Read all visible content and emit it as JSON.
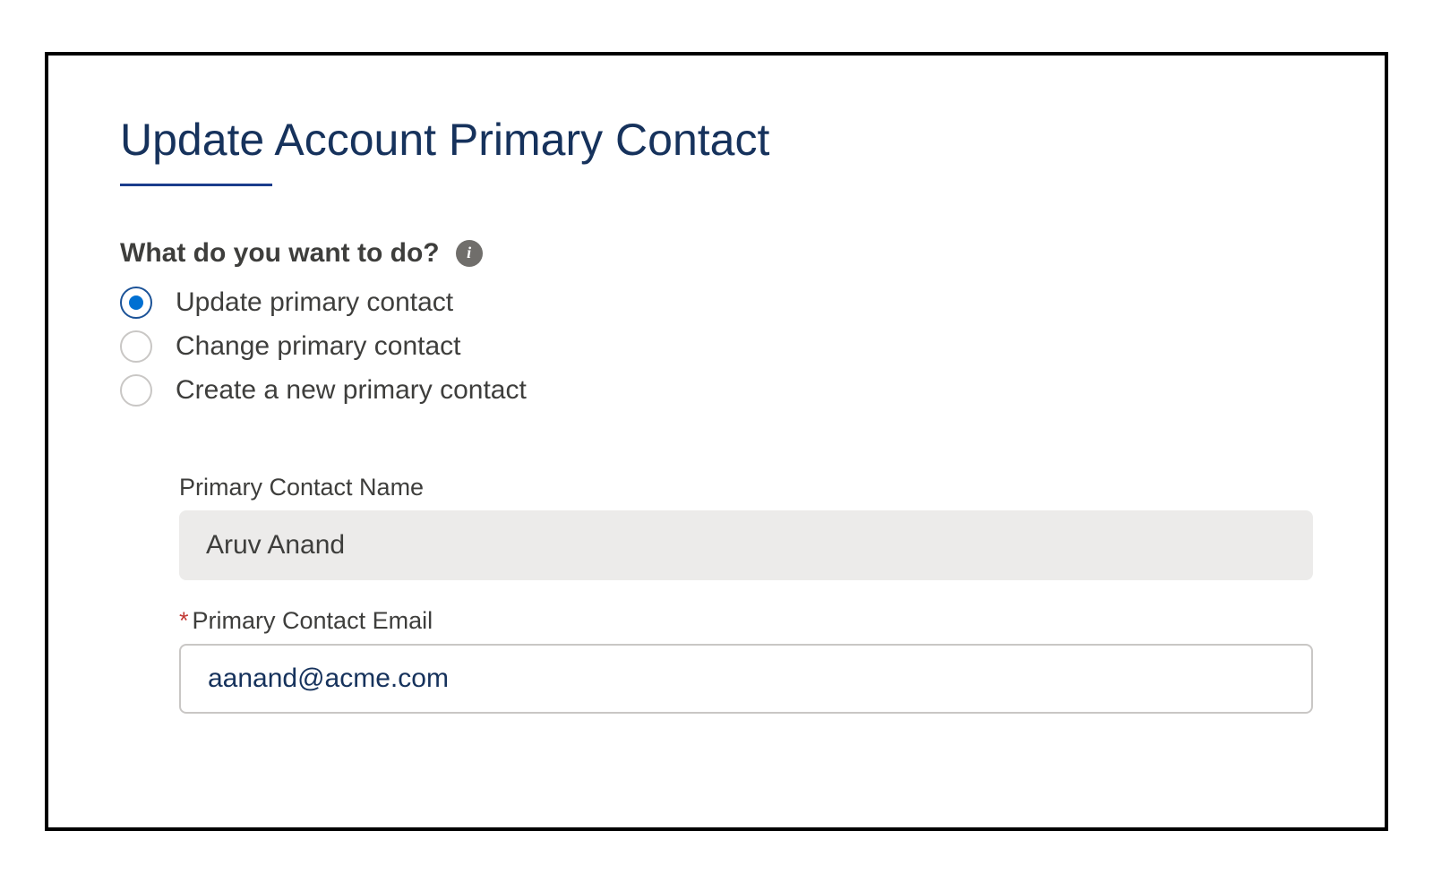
{
  "title": "Update Account Primary Contact",
  "question": {
    "label": "What do you want to do?",
    "info_symbol": "i"
  },
  "options": [
    {
      "label": "Update primary contact",
      "selected": true
    },
    {
      "label": "Change primary contact",
      "selected": false
    },
    {
      "label": "Create a new primary contact",
      "selected": false
    }
  ],
  "fields": {
    "name": {
      "label": "Primary Contact Name",
      "value": "Aruv Anand",
      "required": false,
      "readonly": true
    },
    "email": {
      "label": "Primary Contact Email",
      "value": "aanand@acme.com",
      "required": true,
      "readonly": false,
      "required_mark": "*"
    }
  }
}
